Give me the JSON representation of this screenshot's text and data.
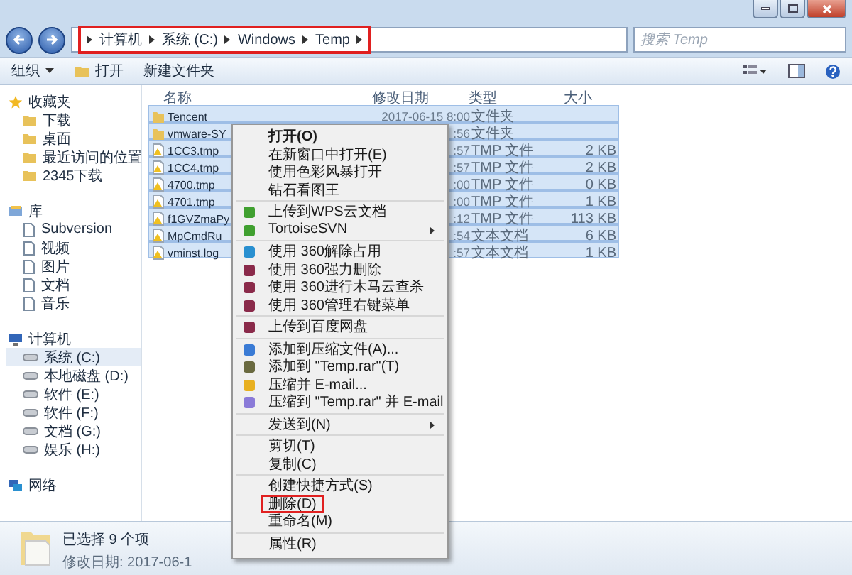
{
  "address_bar": {
    "crumbs": [
      "计算机",
      "系统 (C:)",
      "Windows",
      "Temp"
    ],
    "highlighted": true
  },
  "search": {
    "placeholder": "搜索 Temp"
  },
  "toolbar": {
    "buttons": [
      "组织",
      "打开",
      "新建文件夹"
    ]
  },
  "sidebar": {
    "groups": [
      {
        "label": "收藏夹",
        "items": [
          {
            "label": "下载",
            "selected": false
          },
          {
            "label": "桌面",
            "selected": false
          },
          {
            "label": "最近访问的位置",
            "selected": false
          },
          {
            "label": "2345下载",
            "selected": false
          }
        ]
      },
      {
        "label": "库",
        "items": [
          {
            "label": "Subversion",
            "selected": false
          },
          {
            "label": "视频",
            "selected": false
          },
          {
            "label": "图片",
            "selected": false
          },
          {
            "label": "文档",
            "selected": false
          },
          {
            "label": "音乐",
            "selected": false
          }
        ]
      },
      {
        "label": "计算机",
        "items": [
          {
            "label": "系统 (C:)",
            "selected": true
          },
          {
            "label": "本地磁盘 (D:)",
            "selected": false
          },
          {
            "label": "软件 (E:)",
            "selected": false
          },
          {
            "label": "软件 (F:)",
            "selected": false
          },
          {
            "label": "文档 (G:)",
            "selected": false
          },
          {
            "label": "娱乐 (H:)",
            "selected": false
          }
        ]
      },
      {
        "label": "网络"
      }
    ]
  },
  "table": {
    "columns": [
      "名称",
      "修改日期",
      "类型",
      "大小"
    ],
    "rows": [
      {
        "kind": "folder",
        "name": "Tencent",
        "date": "2017-06-15 8:00",
        "type": "文件夹",
        "size": "",
        "selected": true
      },
      {
        "kind": "folder",
        "name": "vmware-SY",
        "date": ":56",
        "type": "文件夹",
        "size": "",
        "selected": true
      },
      {
        "kind": "file",
        "name": "1CC3.tmp",
        "date": ":57",
        "type": "TMP 文件",
        "size": "2 KB",
        "selected": true
      },
      {
        "kind": "file",
        "name": "1CC4.tmp",
        "date": ":57",
        "type": "TMP 文件",
        "size": "2 KB",
        "selected": true
      },
      {
        "kind": "file",
        "name": "4700.tmp",
        "date": ":00",
        "type": "TMP 文件",
        "size": "0 KB",
        "selected": true
      },
      {
        "kind": "file",
        "name": "4701.tmp",
        "date": ":00",
        "type": "TMP 文件",
        "size": "1 KB",
        "selected": true
      },
      {
        "kind": "file",
        "name": "f1GVZmaPy",
        "date": ":12",
        "type": "TMP 文件",
        "size": "113 KB",
        "selected": true
      },
      {
        "kind": "file",
        "name": "MpCmdRu",
        "date": ":54",
        "type": "文本文档",
        "size": "6 KB",
        "selected": true
      },
      {
        "kind": "file",
        "name": "vminst.log",
        "date": ":57",
        "type": "文本文档",
        "size": "1 KB",
        "selected": true
      }
    ]
  },
  "context_menu": {
    "groups": [
      [
        {
          "label": "打开(O)",
          "kind": "default",
          "highlighted": false,
          "submenu": false
        },
        {
          "label": "在新窗口中打开(E)",
          "kind": "plain",
          "highlighted": false,
          "submenu": false
        },
        {
          "label": "使用色彩风暴打开",
          "kind": "plain",
          "highlighted": false,
          "submenu": false
        },
        {
          "label": "钻石看图王",
          "kind": "plain",
          "highlighted": false,
          "submenu": false
        }
      ],
      [
        {
          "label": "上传到WPS云文档",
          "kind": "app",
          "highlighted": false,
          "submenu": false
        },
        {
          "label": "TortoiseSVN",
          "kind": "app",
          "highlighted": false,
          "submenu": true
        }
      ],
      [
        {
          "label": "使用 360解除占用",
          "kind": "app",
          "highlighted": false,
          "submenu": false
        },
        {
          "label": "使用 360强力删除",
          "kind": "app",
          "highlighted": false,
          "submenu": false
        },
        {
          "label": "使用 360进行木马云查杀",
          "kind": "app",
          "highlighted": false,
          "submenu": false
        },
        {
          "label": "使用 360管理右键菜单",
          "kind": "app",
          "highlighted": false,
          "submenu": false
        }
      ],
      [
        {
          "label": "上传到百度网盘",
          "kind": "app",
          "highlighted": false,
          "submenu": false
        }
      ],
      [
        {
          "label": "添加到压缩文件(A)...",
          "kind": "app",
          "highlighted": false,
          "submenu": false
        },
        {
          "label": "添加到 \"Temp.rar\"(T)",
          "kind": "app",
          "highlighted": false,
          "submenu": false
        },
        {
          "label": "压缩并 E-mail...",
          "kind": "app",
          "highlighted": false,
          "submenu": false
        },
        {
          "label": "压缩到 \"Temp.rar\" 并 E-mail",
          "kind": "app",
          "highlighted": false,
          "submenu": false
        }
      ],
      [
        {
          "label": "发送到(N)",
          "kind": "plain",
          "highlighted": false,
          "submenu": true
        }
      ],
      [
        {
          "label": "剪切(T)",
          "kind": "plain",
          "highlighted": false,
          "submenu": false
        },
        {
          "label": "复制(C)",
          "kind": "plain",
          "highlighted": false,
          "submenu": false
        }
      ],
      [
        {
          "label": "创建快捷方式(S)",
          "kind": "plain",
          "highlighted": false,
          "submenu": false
        },
        {
          "label": "删除(D)",
          "kind": "plain",
          "highlighted": true,
          "submenu": false
        },
        {
          "label": "重命名(M)",
          "kind": "plain",
          "highlighted": false,
          "submenu": false
        }
      ],
      [
        {
          "label": "属性(R)",
          "kind": "plain",
          "highlighted": false,
          "submenu": false
        }
      ]
    ]
  },
  "status_bar": {
    "selection": "已选择 9 个项",
    "detail": "修改日期: 2017-06-1"
  }
}
